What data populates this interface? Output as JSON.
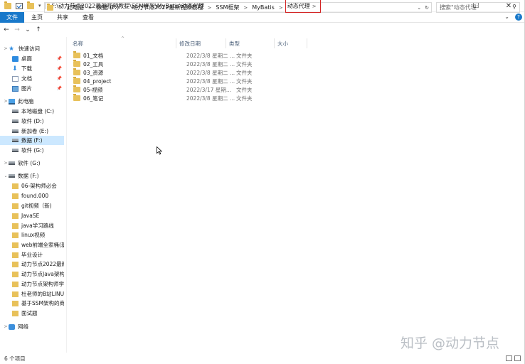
{
  "window": {
    "title": "F:\\动力节点2022最新视频教程\\SSM框架\\MyBatis\\动态代理",
    "controls": {
      "minimize": "—",
      "maximize": "☐",
      "close": "✕"
    }
  },
  "ribbon": {
    "tabs": [
      "文件",
      "主页",
      "共享",
      "查看"
    ],
    "expand": "⌄",
    "help": "?"
  },
  "nav": {
    "back": "←",
    "forward": "→",
    "recent": "⌄",
    "up": "↑"
  },
  "address": {
    "crumbs": [
      "此电脑",
      "数据 (F:)",
      "动力节点2022最新视频教程",
      "SSM框架",
      "MyBatis"
    ],
    "current": "动态代理",
    "dropdown": "⌄",
    "refresh": "↻"
  },
  "search": {
    "placeholder": "搜索\"动态代理\"",
    "icon": "search-icon"
  },
  "sidebar": {
    "items": [
      {
        "label": "快速访问",
        "icon": "star-icon",
        "expander": ""
      },
      {
        "label": "桌面",
        "icon": "desktop-icon",
        "pinned": true
      },
      {
        "label": "下载",
        "icon": "download-icon",
        "pinned": true
      },
      {
        "label": "文档",
        "icon": "documents-icon",
        "pinned": true
      },
      {
        "label": "图片",
        "icon": "pictures-icon",
        "pinned": true
      },
      {
        "label": "此电脑",
        "icon": "pc-icon"
      },
      {
        "label": "本地磁盘 (C:)",
        "icon": "drive-icon"
      },
      {
        "label": "软件 (D:)",
        "icon": "drive-icon"
      },
      {
        "label": "新加卷 (E:)",
        "icon": "drive-icon"
      },
      {
        "label": "数据 (F:)",
        "icon": "drive-icon",
        "selected": true
      },
      {
        "label": "软件 (G:)",
        "icon": "drive-icon"
      },
      {
        "label": "软件 (G:)",
        "icon": "drive-icon"
      },
      {
        "label": "数据 (F:)",
        "icon": "drive-icon"
      },
      {
        "label": "06-架构师必会",
        "icon": "folder-icon"
      },
      {
        "label": "found.000",
        "icon": "folder-icon"
      },
      {
        "label": "git视频（新)",
        "icon": "folder-icon"
      },
      {
        "label": "JavaSE",
        "icon": "folder-icon"
      },
      {
        "label": "java学习路线",
        "icon": "folder-icon"
      },
      {
        "label": "linux视频",
        "icon": "folder-icon"
      },
      {
        "label": "web前端全家桶(基础",
        "icon": "folder-icon"
      },
      {
        "label": "毕业设计",
        "icon": "folder-icon"
      },
      {
        "label": "动力节点2022最新视",
        "icon": "folder-icon"
      },
      {
        "label": "动力节点Java架构师",
        "icon": "folder-icon"
      },
      {
        "label": "动力节点架构师学习",
        "icon": "folder-icon"
      },
      {
        "label": "杜老师的B站LINUX",
        "icon": "folder-icon"
      },
      {
        "label": "基于SSM架构的商品",
        "icon": "folder-icon"
      },
      {
        "label": "面试题",
        "icon": "folder-icon"
      },
      {
        "label": "网络",
        "icon": "network-icon"
      }
    ]
  },
  "columns": {
    "name": "名称",
    "date": "修改日期",
    "type": "类型",
    "size": "大小",
    "sort": "^"
  },
  "files": [
    {
      "name": "01_文档",
      "date": "2022/3/8 星期二 ...",
      "type": "文件夹"
    },
    {
      "name": "02_工具",
      "date": "2022/3/8 星期二 ...",
      "type": "文件夹"
    },
    {
      "name": "03_资源",
      "date": "2022/3/8 星期二 ...",
      "type": "文件夹"
    },
    {
      "name": "04_project",
      "date": "2022/3/8 星期二 ...",
      "type": "文件夹"
    },
    {
      "name": "05-视频",
      "date": "2022/3/17 星期...",
      "type": "文件夹"
    },
    {
      "name": "06_笔记",
      "date": "2022/3/8 星期二 ...",
      "type": "文件夹"
    }
  ],
  "status": {
    "count": "6 个项目"
  },
  "watermark": "知乎 @动力节点",
  "colors": {
    "accent": "#1979ca",
    "selection": "#cce8ff",
    "highlight_box": "#d32323",
    "folder": "#e8c15a"
  }
}
